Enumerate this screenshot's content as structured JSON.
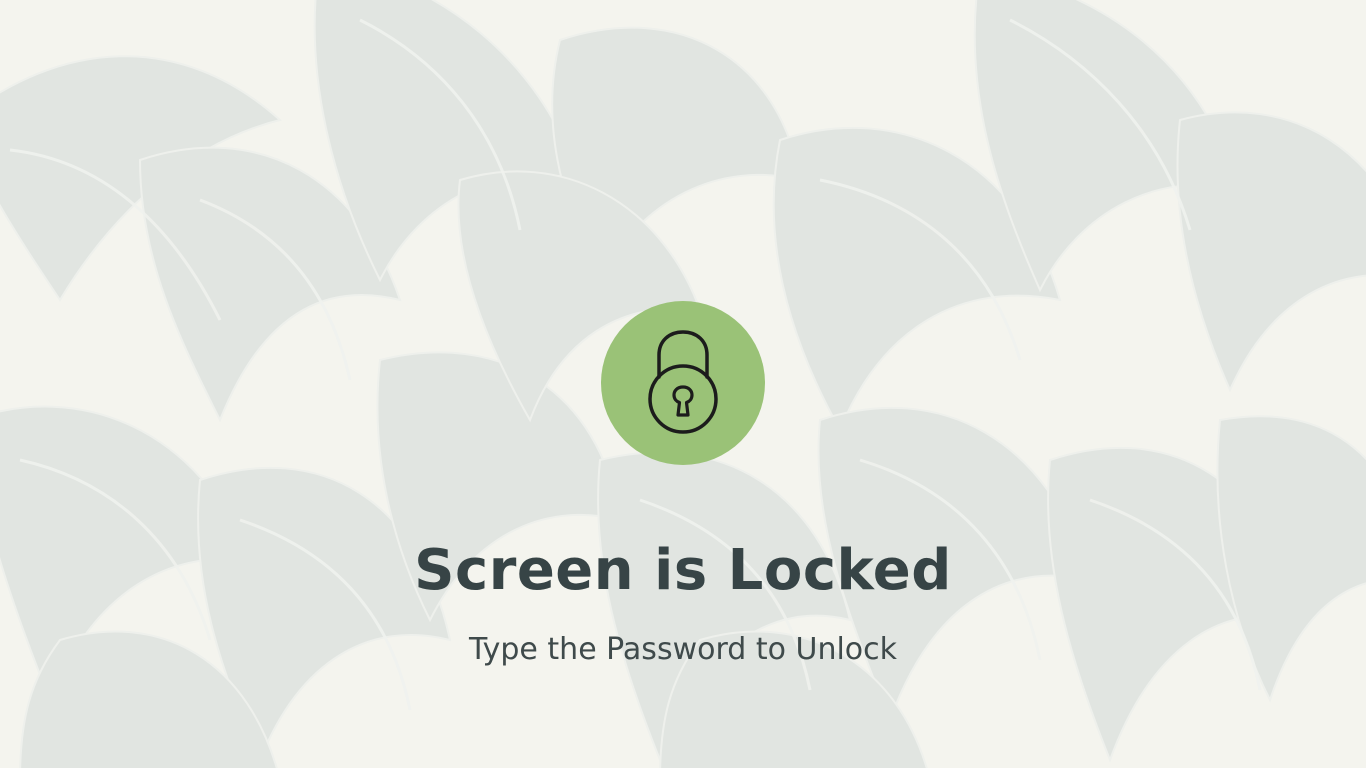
{
  "lock_screen": {
    "title": "Screen is Locked",
    "subtitle": "Type the Password to Unlock",
    "icon": "padlock-icon",
    "accent_color": "#9ac277",
    "text_color": "#374446"
  },
  "wallpaper": {
    "description_icon": "leaf-pattern-wallpaper",
    "base_color": "#f4f4ee",
    "leaf_color": "#dfe3df"
  }
}
